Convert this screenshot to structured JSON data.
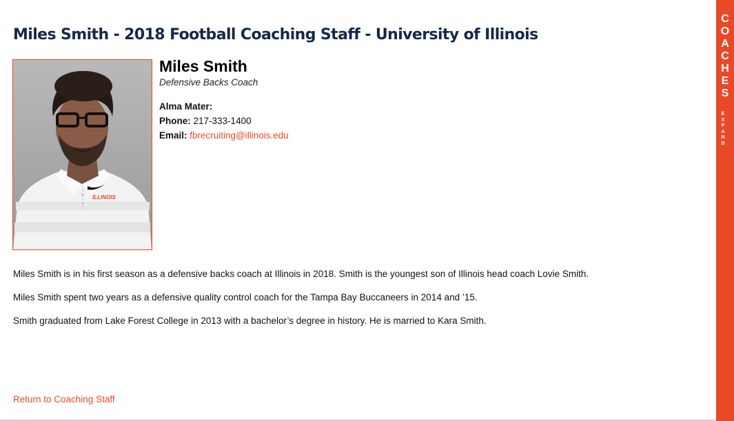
{
  "page": {
    "title": "Miles Smith - 2018 Football Coaching Staff - University of Illinois"
  },
  "coach": {
    "name": "Miles Smith",
    "position": "Defensive Backs Coach",
    "alma_mater_label": "Alma Mater:",
    "alma_mater_value": "",
    "phone_label": "Phone:",
    "phone_value": "217-333-1400",
    "email_label": "Email:",
    "email_value": "fbrecruiting@illinois.edu",
    "photo_shirt_text": "ILLINOIS"
  },
  "bio": [
    "Miles Smith is in his first season as a defensive backs coach at Illinois in 2018. Smith is the youngest son of Illinois head coach Lovie Smith.",
    "Miles Smith spent two years as a defensive quality control coach for the Tampa Bay Buccaneers in 2014 and ’15.",
    "Smith graduated from Lake Forest College in 2013 with a bachelor’s degree in history. He is married to Kara Smith."
  ],
  "links": {
    "return_label": "Return to Coaching Staff"
  },
  "side_tab": {
    "label_letters": [
      "C",
      "O",
      "A",
      "C",
      "H",
      "E",
      "S"
    ],
    "expand_letters": [
      "E",
      "X",
      "P",
      "A",
      "N",
      "D"
    ]
  },
  "colors": {
    "accent": "#E84A27",
    "navy": "#13294B"
  }
}
